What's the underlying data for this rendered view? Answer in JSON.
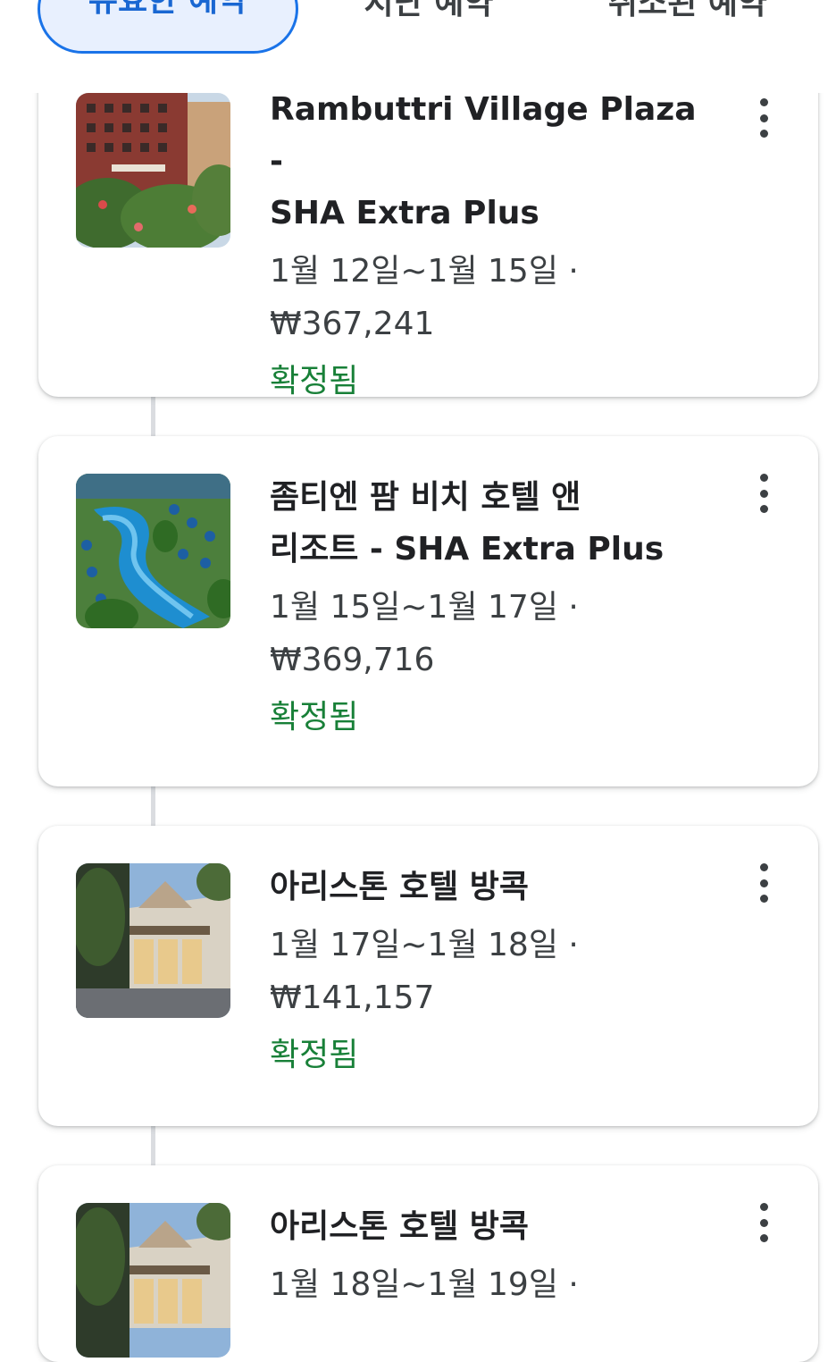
{
  "tabs": [
    {
      "label": "유효한 예약",
      "active": true
    },
    {
      "label": "지난 예약",
      "active": false
    },
    {
      "label": "취소된 예약",
      "active": false
    }
  ],
  "bookings": [
    {
      "title_line1": "Rambuttri Village Plaza -",
      "title_line2": "SHA Extra Plus",
      "dates": "1월 12일~1월 15일 ·",
      "price": "₩367,241",
      "status": "확정됨",
      "thumbnail_icon": "hotel-courtyard-photo"
    },
    {
      "title_line1": "좀티엔 팜 비치 호텔 앤",
      "title_line2": "리조트 - SHA Extra Plus",
      "dates": "1월 15일~1월 17일 ·",
      "price": "₩369,716",
      "status": "확정됨",
      "thumbnail_icon": "resort-pool-photo"
    },
    {
      "title_line1": "아리스톤 호텔 방콕",
      "dates": "1월 17일~1월 18일 ·",
      "price": "₩141,157",
      "status": "확정됨",
      "thumbnail_icon": "hotel-entrance-photo"
    },
    {
      "title_line1": "아리스톤 호텔 방콕",
      "dates": "1월 18일~1월 19일 ·",
      "thumbnail_icon": "hotel-entrance-photo"
    }
  ],
  "colors": {
    "accent": "#1a73e8",
    "active_tab_bg": "#e8f0fe",
    "status_green": "#188038",
    "timeline": "#dadce0"
  }
}
